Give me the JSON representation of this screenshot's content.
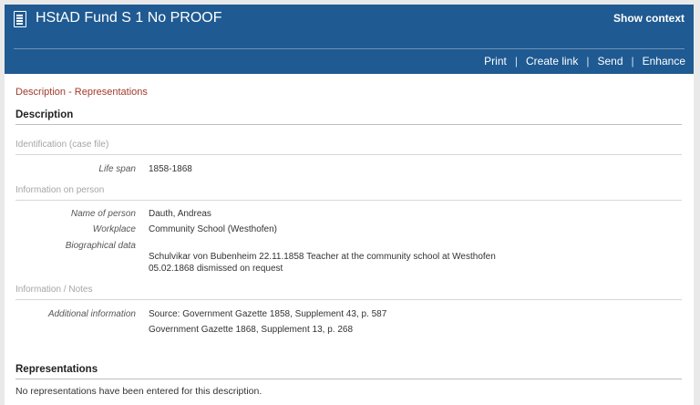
{
  "header": {
    "title": "HStAD Fund S 1 No PROOF",
    "show_context": "Show context",
    "actions": [
      "Print",
      "Create link",
      "Send",
      "Enhance"
    ],
    "separator": "|"
  },
  "breadcrumb": "Description - Representations",
  "description": {
    "heading": "Description",
    "groups": [
      {
        "label": "Identification (case file)",
        "fields": [
          {
            "label": "Life span",
            "value": "1858-1868"
          }
        ]
      },
      {
        "label": "Information on person",
        "fields": [
          {
            "label": "Name of person",
            "value": "Dauth, Andreas"
          },
          {
            "label": "Workplace",
            "value": "Community School (Westhofen)"
          },
          {
            "label": "Biographical data",
            "value_lines": [
              "Schulvikar von Bubenheim 22.11.1858 Teacher at the community school at Westhofen",
              "05.02.1868 dismissed on request"
            ]
          }
        ]
      },
      {
        "label": "Information / Notes",
        "fields": [
          {
            "label": "Additional information",
            "value_lines": [
              "Source: Government Gazette 1858, Supplement 43, p. 587",
              "Government Gazette 1868, Supplement 13, p. 268"
            ]
          }
        ]
      }
    ]
  },
  "representations": {
    "heading": "Representations",
    "empty_text": "No representations have been entered for this description."
  },
  "colors": {
    "header_bg": "#1f5a92",
    "breadcrumb": "#a13a2b"
  },
  "icons": {
    "title_icon": "document-icon"
  }
}
